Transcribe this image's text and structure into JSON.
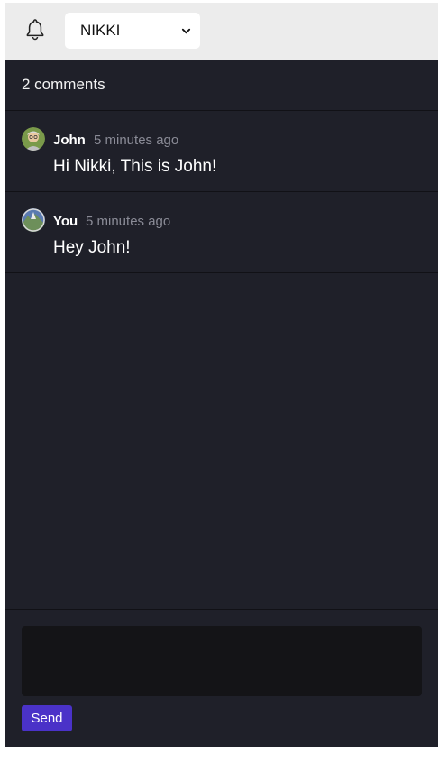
{
  "header": {
    "bell_icon": "bell-icon",
    "user_select": {
      "selected": "NIKKI"
    }
  },
  "comments": {
    "count_label": "2 comments",
    "items": [
      {
        "author": "John",
        "time": "5 minutes ago",
        "body": "Hi Nikki, This is John!"
      },
      {
        "author": "You",
        "time": "5 minutes ago",
        "body": "Hey John!"
      }
    ]
  },
  "composer": {
    "text_value": "",
    "send_label": "Send"
  },
  "colors": {
    "panel_bg": "#1f2029",
    "topbar_bg": "#ececec",
    "send_button": "#4a32c8",
    "muted_text": "#8a8b96"
  }
}
